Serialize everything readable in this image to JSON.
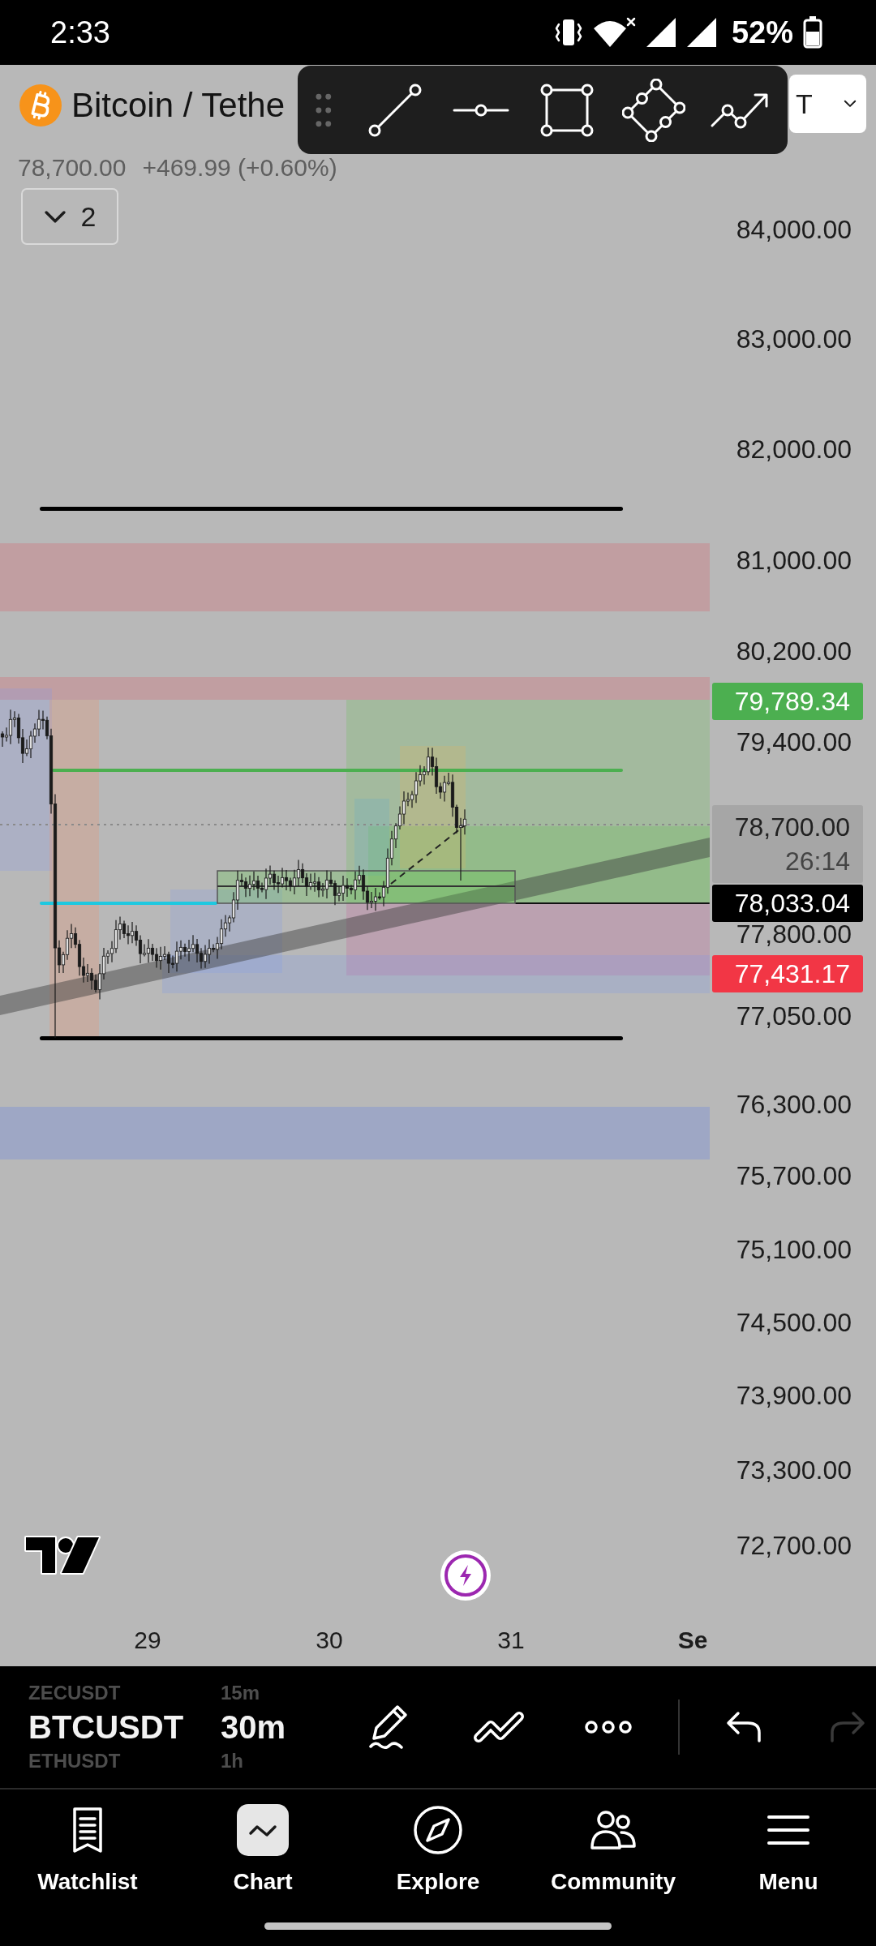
{
  "status_bar": {
    "time": "2:33",
    "battery": "52%"
  },
  "header": {
    "title": "Bitcoin / Tethe",
    "price": "78,700.00",
    "change": "+469.99 (+0.60%)",
    "currency_select": "T",
    "indicators": {
      "count": "2",
      "expanded": false
    }
  },
  "price_axis": [
    "84,000.00",
    "83,000.00",
    "82,000.00",
    "81,000.00",
    "80,200.00",
    "79,400.00",
    "77,800.00",
    "77,050.00",
    "76,300.00",
    "75,700.00",
    "75,100.00",
    "74,500.00",
    "73,900.00",
    "73,300.00",
    "72,700.00"
  ],
  "price_tags": [
    {
      "value": "79,789.34",
      "color": "#4caf50"
    },
    {
      "value": "78,700.00",
      "countdown": "26:14",
      "color": "#a6a6a6"
    },
    {
      "value": "78,033.04",
      "color": "#000000"
    },
    {
      "value": "77,431.17",
      "color": "#f23645"
    }
  ],
  "time_axis": [
    {
      "label": "29",
      "kind": "day"
    },
    {
      "label": "30",
      "kind": "day"
    },
    {
      "label": "31",
      "kind": "day"
    },
    {
      "label": "Se",
      "kind": "month"
    }
  ],
  "symbol_picker": [
    {
      "symbol": "ZECUSDT",
      "interval": "15m",
      "selected": false
    },
    {
      "symbol": "BTCUSDT",
      "interval": "30m",
      "selected": true
    },
    {
      "symbol": "ETHUSDT",
      "interval": "1h",
      "selected": false
    }
  ],
  "chart_tools": {
    "undo": {
      "disabled": false
    },
    "redo": {
      "disabled": true
    }
  },
  "tab_bar": [
    {
      "label": "Watchlist",
      "selected": false
    },
    {
      "label": "Chart",
      "selected": true
    },
    {
      "label": "Explore",
      "selected": false
    },
    {
      "label": "Community",
      "selected": false
    },
    {
      "label": "Menu",
      "selected": false
    }
  ]
}
